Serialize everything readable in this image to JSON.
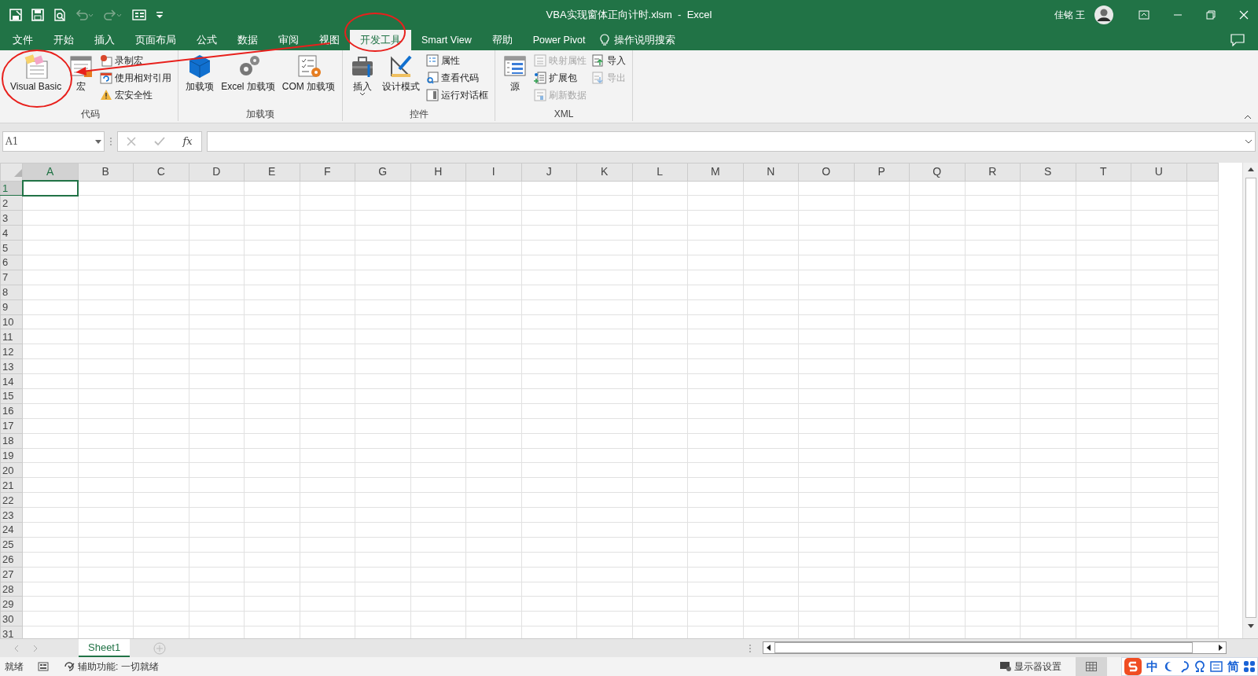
{
  "window": {
    "title": "VBA实现窗体正向计时.xlsm  -  Excel",
    "user_name": "佳铭 王"
  },
  "tabs": [
    {
      "label": "文件",
      "selected": false
    },
    {
      "label": "开始",
      "selected": false
    },
    {
      "label": "插入",
      "selected": false
    },
    {
      "label": "页面布局",
      "selected": false
    },
    {
      "label": "公式",
      "selected": false
    },
    {
      "label": "数据",
      "selected": false
    },
    {
      "label": "审阅",
      "selected": false
    },
    {
      "label": "视图",
      "selected": false
    },
    {
      "label": "开发工具",
      "selected": true
    },
    {
      "label": "Smart View",
      "selected": false
    },
    {
      "label": "帮助",
      "selected": false
    },
    {
      "label": "Power Pivot",
      "selected": false
    }
  ],
  "tell_me": {
    "label": "操作说明搜索"
  },
  "ribbon_groups": [
    {
      "label": "代码",
      "items": [
        {
          "kind": "large",
          "label": "Visual Basic",
          "disabled": false
        },
        {
          "kind": "large",
          "label": "宏",
          "disabled": false
        },
        {
          "kind": "small",
          "label": "录制宏",
          "disabled": false
        },
        {
          "kind": "small",
          "label": "使用相对引用",
          "disabled": false
        },
        {
          "kind": "small",
          "label": "宏安全性",
          "disabled": false
        }
      ]
    },
    {
      "label": "加载项",
      "items": [
        {
          "kind": "large",
          "label": "加载项",
          "disabled": false
        },
        {
          "kind": "large",
          "label": "Excel 加载项",
          "disabled": false
        },
        {
          "kind": "large",
          "label": "COM 加载项",
          "disabled": false
        }
      ]
    },
    {
      "label": "控件",
      "items": [
        {
          "kind": "menu",
          "label": "插入",
          "disabled": false
        },
        {
          "kind": "large",
          "label": "设计模式",
          "disabled": false
        },
        {
          "kind": "small",
          "label": "属性",
          "disabled": false
        },
        {
          "kind": "small",
          "label": "查看代码",
          "disabled": false
        },
        {
          "kind": "small",
          "label": "运行对话框",
          "disabled": false
        }
      ]
    },
    {
      "label": "XML",
      "items": [
        {
          "kind": "large",
          "label": "源",
          "disabled": false
        },
        {
          "kind": "small",
          "label": "映射属性",
          "disabled": true
        },
        {
          "kind": "small",
          "label": "扩展包",
          "disabled": false
        },
        {
          "kind": "small",
          "label": "刷新数据",
          "disabled": true
        },
        {
          "kind": "small",
          "label": "导入",
          "disabled": false
        },
        {
          "kind": "small",
          "label": "导出",
          "disabled": true
        }
      ]
    }
  ],
  "formula_bar": {
    "name_box": "A1",
    "function_label": "fx"
  },
  "columns": [
    {
      "label": "A",
      "selected": true
    },
    {
      "label": "B",
      "selected": false
    },
    {
      "label": "C",
      "selected": false
    },
    {
      "label": "D",
      "selected": false
    },
    {
      "label": "E",
      "selected": false
    },
    {
      "label": "F",
      "selected": false
    },
    {
      "label": "G",
      "selected": false
    },
    {
      "label": "H",
      "selected": false
    },
    {
      "label": "I",
      "selected": false
    },
    {
      "label": "J",
      "selected": false
    },
    {
      "label": "K",
      "selected": false
    },
    {
      "label": "L",
      "selected": false
    },
    {
      "label": "M",
      "selected": false
    },
    {
      "label": "N",
      "selected": false
    },
    {
      "label": "O",
      "selected": false
    },
    {
      "label": "P",
      "selected": false
    },
    {
      "label": "Q",
      "selected": false
    },
    {
      "label": "R",
      "selected": false
    },
    {
      "label": "S",
      "selected": false
    },
    {
      "label": "T",
      "selected": false
    },
    {
      "label": "U",
      "selected": false
    }
  ],
  "rows": [
    {
      "label": "1",
      "selected": true
    },
    {
      "label": "2",
      "selected": false
    },
    {
      "label": "3",
      "selected": false
    },
    {
      "label": "4",
      "selected": false
    },
    {
      "label": "5",
      "selected": false
    },
    {
      "label": "6",
      "selected": false
    },
    {
      "label": "7",
      "selected": false
    },
    {
      "label": "8",
      "selected": false
    },
    {
      "label": "9",
      "selected": false
    },
    {
      "label": "10",
      "selected": false
    },
    {
      "label": "11",
      "selected": false
    },
    {
      "label": "12",
      "selected": false
    },
    {
      "label": "13",
      "selected": false
    },
    {
      "label": "14",
      "selected": false
    },
    {
      "label": "15",
      "selected": false
    },
    {
      "label": "16",
      "selected": false
    },
    {
      "label": "17",
      "selected": false
    },
    {
      "label": "18",
      "selected": false
    },
    {
      "label": "19",
      "selected": false
    },
    {
      "label": "20",
      "selected": false
    },
    {
      "label": "21",
      "selected": false
    },
    {
      "label": "22",
      "selected": false
    },
    {
      "label": "23",
      "selected": false
    },
    {
      "label": "24",
      "selected": false
    },
    {
      "label": "25",
      "selected": false
    },
    {
      "label": "26",
      "selected": false
    },
    {
      "label": "27",
      "selected": false
    },
    {
      "label": "28",
      "selected": false
    },
    {
      "label": "29",
      "selected": false
    },
    {
      "label": "30",
      "selected": false
    },
    {
      "label": "31",
      "selected": false
    }
  ],
  "sheets": [
    {
      "label": "Sheet1",
      "selected": true
    }
  ],
  "status_bar": {
    "ready": "就绪",
    "accessibility": "辅助功能: 一切就绪",
    "display_settings": "显示器设置"
  },
  "ime_bar": {
    "language": "中",
    "script": "简"
  }
}
